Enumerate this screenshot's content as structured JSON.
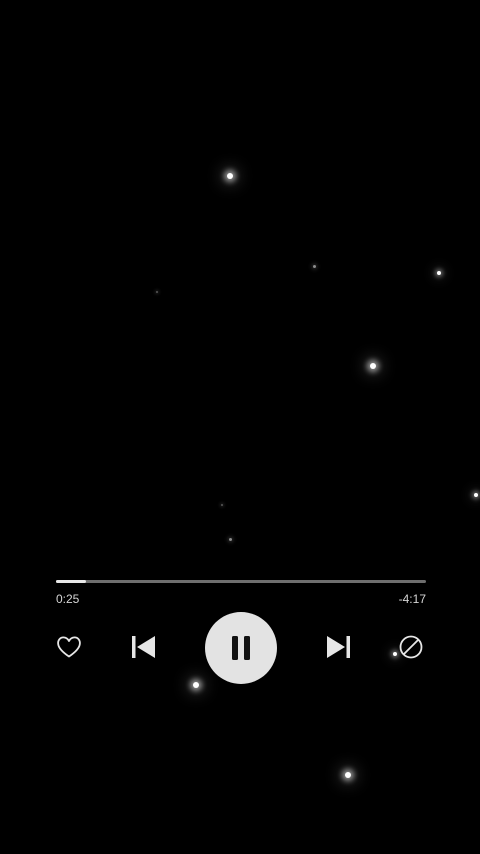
{
  "player": {
    "elapsed": "0:25",
    "remaining": "-4:17",
    "progress_fraction": 0.08
  },
  "controls": {
    "like_icon": "heart-outline-icon",
    "previous_icon": "skip-previous-icon",
    "play_pause_icon": "pause-icon",
    "next_icon": "skip-next-icon",
    "block_icon": "block-icon"
  },
  "colors": {
    "background": "#000000",
    "accent": "#e3e3e3",
    "track": "#6e6e6e",
    "text": "#d6d6d6"
  }
}
